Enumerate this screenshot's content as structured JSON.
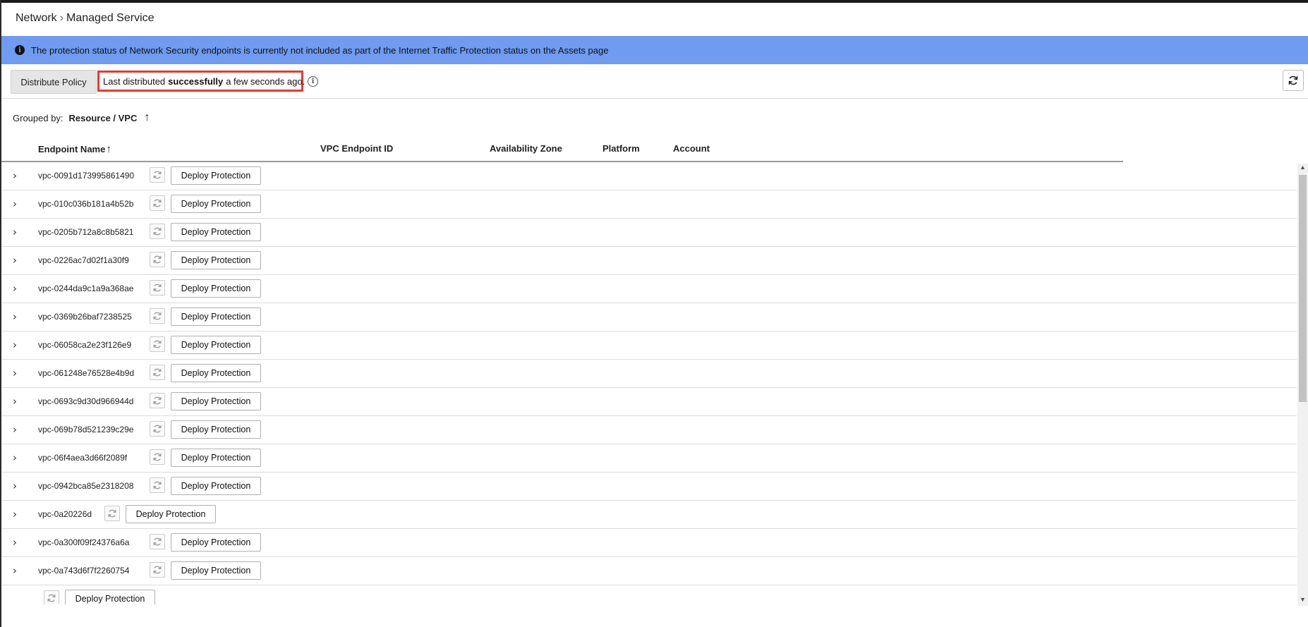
{
  "breadcrumb": {
    "parent": "Network",
    "separator": "›",
    "current": "Managed Service"
  },
  "banner": {
    "text": "The protection status of Network Security endpoints is currently not included as part of the Internet Traffic Protection status on the Assets page",
    "color": "#6f9bf0"
  },
  "toolbar": {
    "distribute_label": "Distribute Policy",
    "status_prefix": "Last distributed",
    "status_bold": "successfully",
    "status_suffix": "a few seconds ago.",
    "highlight_color": "#e8392f"
  },
  "grouping": {
    "label": "Grouped by:",
    "value": "Resource / VPC",
    "sort_arrow": "↑"
  },
  "table": {
    "columns": [
      "Endpoint Name",
      "VPC Endpoint ID",
      "Availability Zone",
      "Platform",
      "Account"
    ],
    "sort_arrow": "↑",
    "action_label": "Deploy Protection",
    "rows": [
      {
        "name": "vpc-0091d173995861490"
      },
      {
        "name": "vpc-010c036b181a4b52b"
      },
      {
        "name": "vpc-0205b712a8c8b5821"
      },
      {
        "name": "vpc-0226ac7d02f1a30f9"
      },
      {
        "name": "vpc-0244da9c1a9a368ae"
      },
      {
        "name": "vpc-0369b26baf7238525"
      },
      {
        "name": "vpc-06058ca2e23f126e9"
      },
      {
        "name": "vpc-061248e76528e4b9d"
      },
      {
        "name": "vpc-0693c9d30d966944d"
      },
      {
        "name": "vpc-069b78d521239c29e"
      },
      {
        "name": "vpc-06f4aea3d66f2089f"
      },
      {
        "name": "vpc-0942bca85e2318208"
      },
      {
        "name": "vpc-0a20226d"
      },
      {
        "name": "vpc-0a300f09f24376a6a"
      },
      {
        "name": "vpc-0a743d6f7f2260754"
      },
      {
        "name": ""
      }
    ]
  },
  "icons": {
    "info": "info-icon",
    "refresh": "refresh-icon",
    "sync": "sync-icon",
    "expand": "chevron-right-icon"
  }
}
